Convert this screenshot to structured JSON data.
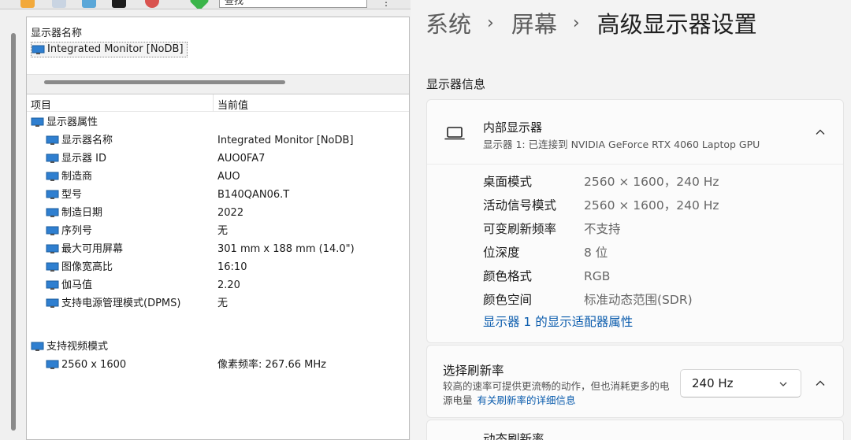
{
  "left": {
    "search": {
      "value": "查找"
    },
    "top_section": {
      "heading": "显示器名称",
      "value": "Integrated Monitor [NoDB]"
    },
    "columns": {
      "item": "项目",
      "current": "当前值"
    },
    "groups": [
      {
        "label": "显示器属性",
        "rows": [
          {
            "name": "显示器名称",
            "value": "Integrated Monitor [NoDB]"
          },
          {
            "name": "显示器 ID",
            "value": "AUO0FA7"
          },
          {
            "name": "制造商",
            "value": "AUO"
          },
          {
            "name": "型号",
            "value": "B140QAN06.T"
          },
          {
            "name": "制造日期",
            "value": "2022"
          },
          {
            "name": "序列号",
            "value": "无"
          },
          {
            "name": "最大可用屏幕",
            "value": "301 mm x 188 mm (14.0\")"
          },
          {
            "name": "图像宽高比",
            "value": "16:10"
          },
          {
            "name": "伽马值",
            "value": "2.20"
          },
          {
            "name": "支持电源管理模式(DPMS)",
            "value": "无"
          }
        ]
      },
      {
        "label": "支持视频模式",
        "rows": [
          {
            "name": "2560 x 1600",
            "value": "像素频率: 267.66 MHz"
          }
        ]
      }
    ]
  },
  "right": {
    "breadcrumb": [
      "系统",
      "屏幕",
      "高级显示器设置"
    ],
    "section_label": "显示器信息",
    "display": {
      "title": "内部显示器",
      "subtitle": "显示器 1: 已连接到 NVIDIA GeForce RTX 4060 Laptop GPU",
      "rows": [
        {
          "key": "桌面模式",
          "value": "2560 × 1600，240 Hz"
        },
        {
          "key": "活动信号模式",
          "value": "2560 × 1600，240 Hz"
        },
        {
          "key": "可变刷新频率",
          "value": "不支持"
        },
        {
          "key": "位深度",
          "value": "8 位"
        },
        {
          "key": "颜色格式",
          "value": "RGB"
        },
        {
          "key": "颜色空间",
          "value": "标准动态范围(SDR)"
        }
      ],
      "adapter_link": "显示器 1 的显示适配器属性"
    },
    "refresh": {
      "title": "选择刷新率",
      "desc": "较高的速率可提供更流畅的动作，但也消耗更多的电源电量",
      "link": "有关刷新率的详细信息",
      "selected": "240 Hz"
    },
    "dynamic_refresh": {
      "label": "动态刷新率"
    }
  },
  "colors": {
    "link": "#0b5cad",
    "monitor_icon": "#2f7fd0"
  },
  "icons": {
    "tree_item": "monitor-icon",
    "display": "laptop-icon",
    "expand": "chevron-up-icon",
    "dropdown": "chevron-down-icon"
  }
}
